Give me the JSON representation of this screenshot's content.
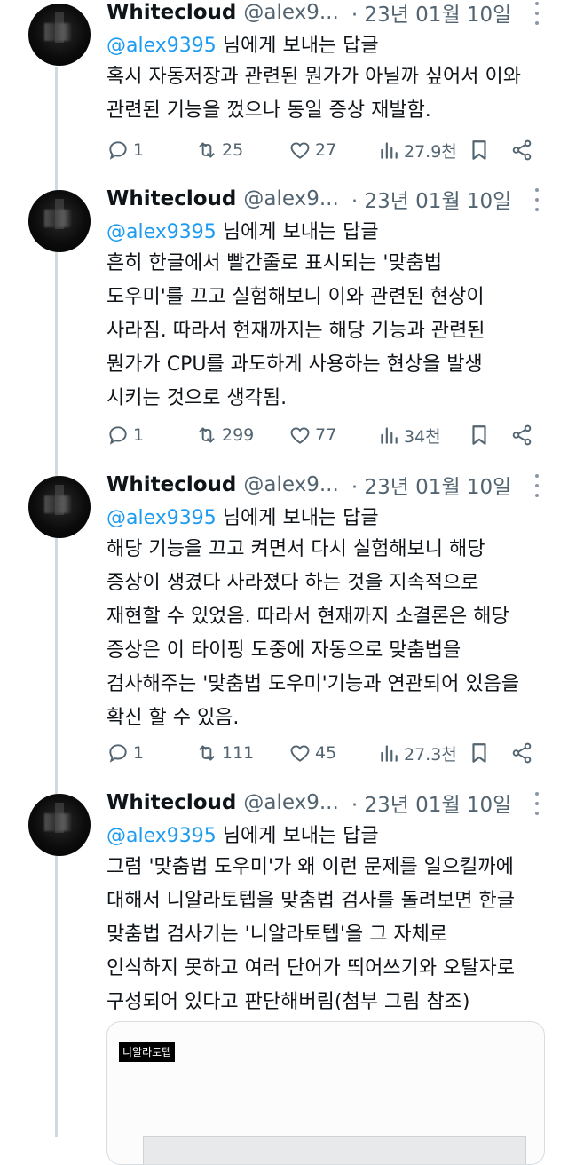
{
  "tweets": [
    {
      "name": "Whitecloud",
      "handle": "@alex9...",
      "date": "· 23년 01월 10일",
      "reply_mention": "@alex9395",
      "reply_suffix": " 님에게 보내는 답글",
      "lines": [
        "혹시 자동저장과 관련된 뭔가가 아닐까 싶어서 이와",
        "관련된 기능을 껐으나 동일 증상 재발함."
      ],
      "replies": "1",
      "retweets": "25",
      "likes": "27",
      "views": "27.9천"
    },
    {
      "name": "Whitecloud",
      "handle": "@alex9...",
      "date": "· 23년 01월 10일",
      "reply_mention": "@alex9395",
      "reply_suffix": " 님에게 보내는 답글",
      "lines": [
        "흔히 한글에서 빨간줄로 표시되는 '맞춤법",
        "도우미'를 끄고 실험해보니 이와 관련된 현상이",
        "사라짐. 따라서 현재까지는 해당 기능과 관련된",
        "뭔가가 CPU를 과도하게 사용하는 현상을 발생",
        "시키는 것으로 생각됨."
      ],
      "replies": "1",
      "retweets": "299",
      "likes": "77",
      "views": "34천"
    },
    {
      "name": "Whitecloud",
      "handle": "@alex9...",
      "date": "· 23년 01월 10일",
      "reply_mention": "@alex9395",
      "reply_suffix": " 님에게 보내는 답글",
      "lines": [
        "해당 기능을 끄고 켜면서 다시 실험해보니 해당",
        "증상이 생겼다 사라졌다 하는 것을 지속적으로",
        "재현할 수 있었음. 따라서 현재까지 소결론은 해당",
        "증상은 이 타이핑 도중에 자동으로 맞춤법을",
        "검사해주는 '맞춤법 도우미'기능과 연관되어 있음을",
        "확신 할 수 있음."
      ],
      "replies": "1",
      "retweets": "111",
      "likes": "45",
      "views": "27.3천"
    },
    {
      "name": "Whitecloud",
      "handle": "@alex9...",
      "date": "· 23년 01월 10일",
      "reply_mention": "@alex9395",
      "reply_suffix": " 님에게 보내는 답글",
      "lines": [
        "그럼 '맞춤법 도우미'가 왜 이런 문제를 일으킬까에",
        "대해서 니알라토텝을 맞춤법 검사를 돌려보면 한글",
        "맞춤법 검사기는 '니알라토텝'을 그 자체로",
        "인식하지 못하고 여러 단어가 띄어쓰기와 오탈자로",
        "구성되어 있다고 판단해버림(첨부 그림 참조)"
      ]
    }
  ],
  "attachment": {
    "label": "니알라토텝"
  },
  "icons": [
    "reply-icon",
    "retweet-icon",
    "like-icon",
    "views-icon",
    "bookmark-icon",
    "share-icon",
    "more-icon"
  ],
  "colors": {
    "mention": "#1d9bf0",
    "muted": "#536471",
    "text": "#0f1419"
  }
}
